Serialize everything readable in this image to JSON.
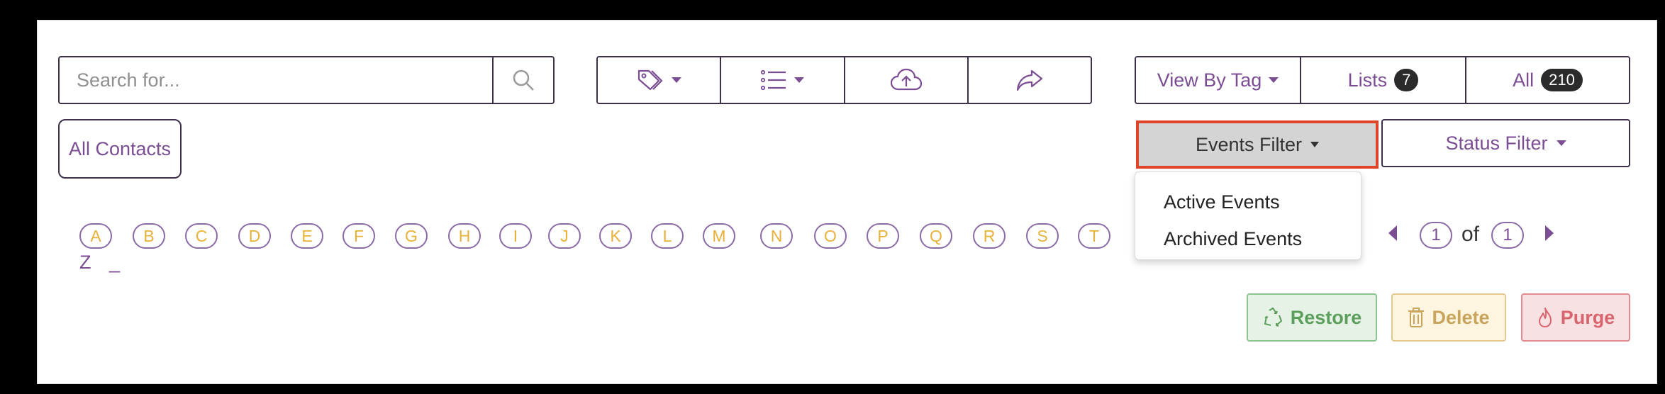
{
  "search": {
    "placeholder": "Search for..."
  },
  "toolbar": {
    "tag_icon": "tag-icon",
    "list_icon": "list-icon",
    "upload_icon": "cloud-upload-icon",
    "share_icon": "share-icon"
  },
  "view": {
    "by_tag_label": "View By Tag",
    "lists_label": "Lists",
    "lists_count": "7",
    "all_label": "All",
    "all_count": "210"
  },
  "all_contacts_label": "All Contacts",
  "filters": {
    "events_label": "Events Filter",
    "status_label": "Status Filter"
  },
  "events_dropdown": {
    "options": [
      "Active Events",
      "Archived Events"
    ]
  },
  "alphabet": {
    "letters": [
      "A",
      "B",
      "C",
      "D",
      "E",
      "F",
      "G",
      "H",
      "I",
      "J",
      "K",
      "L",
      "M",
      "N",
      "O",
      "P",
      "Q",
      "R",
      "S",
      "T"
    ],
    "second_row": [
      "Z",
      "_"
    ]
  },
  "pagination": {
    "current": "1",
    "of_label": "of",
    "total": "1"
  },
  "actions": {
    "restore_label": "Restore",
    "delete_label": "Delete",
    "purge_label": "Purge"
  },
  "colors": {
    "accent": "#7b4d93",
    "border": "#3e2f4a",
    "letter": "#e8b23a",
    "highlight": "#e0442b"
  }
}
